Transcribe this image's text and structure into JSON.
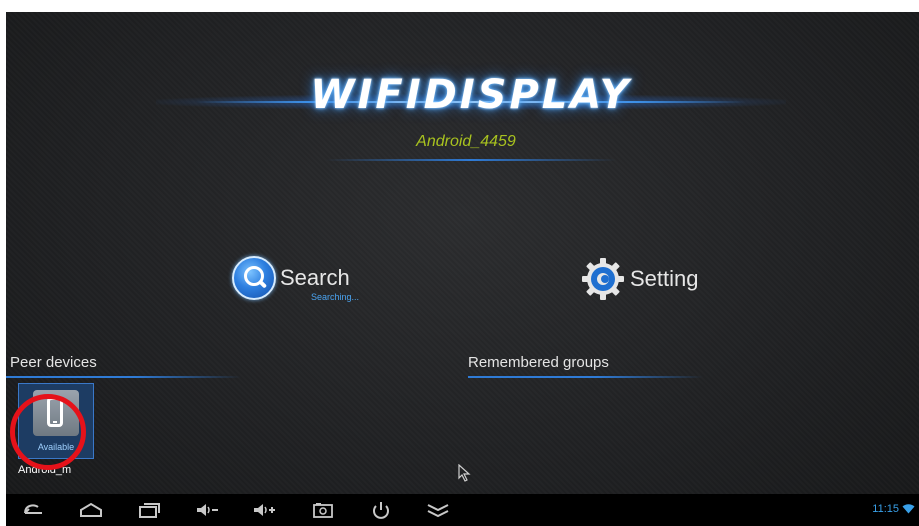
{
  "app": {
    "logo_text": "WIFIDISPLAY",
    "device_name": "Android_4459"
  },
  "actions": {
    "search_label": "Search",
    "search_status": "Searching...",
    "setting_label": "Setting"
  },
  "sections": {
    "peer_devices_title": "Peer devices",
    "remembered_groups_title": "Remembered groups"
  },
  "peer_devices": [
    {
      "name": "Android_m",
      "status": "Available",
      "icon": "smartphone-icon"
    }
  ],
  "navbar": {
    "buttons": [
      "back-icon",
      "home-icon",
      "recent-apps-icon",
      "volume-down-icon",
      "volume-up-icon",
      "screenshot-icon",
      "power-icon",
      "expand-icon"
    ],
    "clock": "11:15",
    "status_icon": "wifi-icon"
  },
  "colors": {
    "accent_blue": "#2f7bd6",
    "device_name": "#a8c21f",
    "highlight": "#e5121a",
    "clock": "#39a0e8"
  }
}
